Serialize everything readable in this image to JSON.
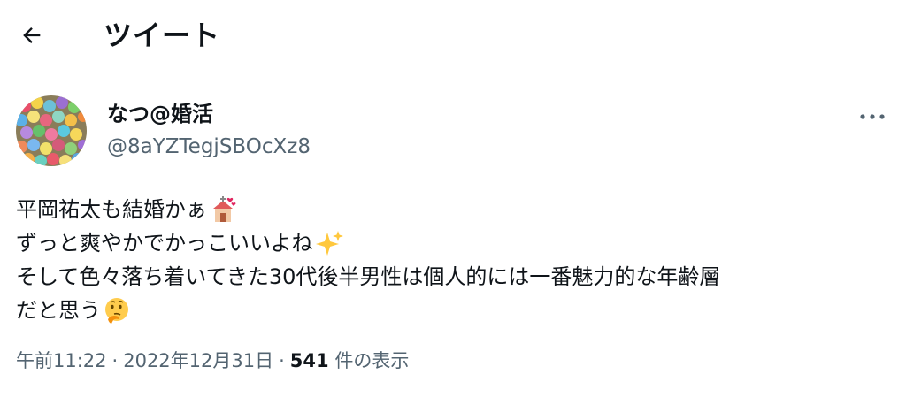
{
  "header": {
    "back_icon": "arrow-left-icon",
    "title": "ツイート"
  },
  "author": {
    "display_name": "なつ@婚活",
    "handle": "@8aYZTegjSBOcXz8",
    "avatar": "colorful-candy-avatar"
  },
  "more_icon": "ellipsis-icon",
  "tweet": {
    "lines": [
      {
        "text": "平岡祐太も結婚かぁ",
        "emoji": "wedding-chapel-icon"
      },
      {
        "text": "ずっと爽やかでかっこいいよね",
        "emoji": "sparkles-icon"
      },
      {
        "text": "そして色々落ち着いてきた30代後半男性は個人的には一番魅力的な年齢層",
        "emoji": ""
      },
      {
        "text": "だと思う",
        "emoji": "thinking-face-icon"
      }
    ]
  },
  "meta": {
    "time": "午前11:22",
    "separator": "·",
    "date": "2022年12月31日",
    "views_count": "541",
    "views_label": "件の表示"
  },
  "colors": {
    "text": "#0f1419",
    "secondary": "#536471"
  }
}
